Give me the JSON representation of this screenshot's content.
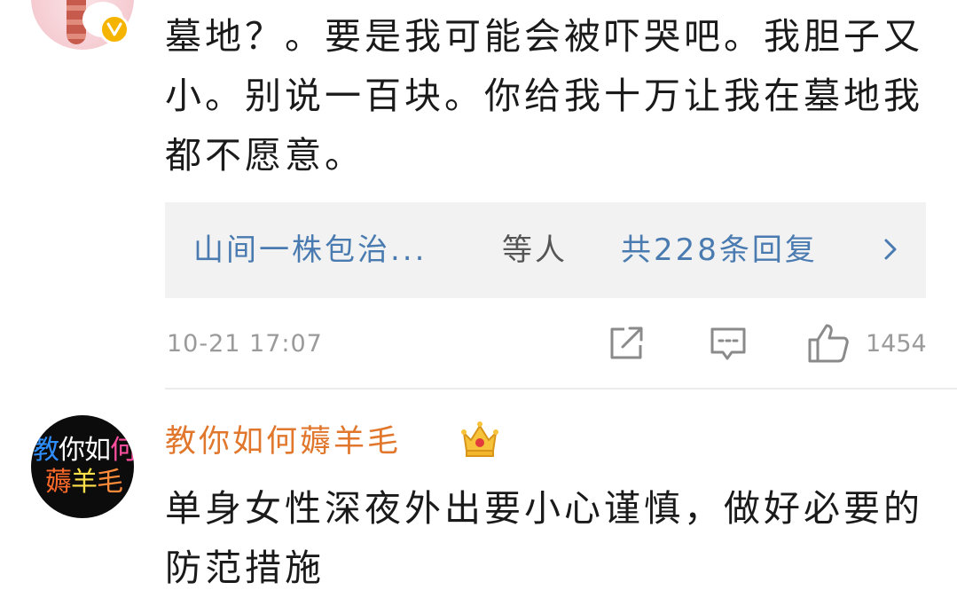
{
  "comments": [
    {
      "text": "墓地？。要是我可能会被吓哭吧。我胆子又小。别说一百块。你给我十万让我在墓地我都不愿意。",
      "verified_badge": "v-badge-icon",
      "replies": {
        "names": "山间一株包治...",
        "suffix": "等人",
        "count_label": "共228条回复"
      },
      "time": "10-21  17:07",
      "like_count": "1454"
    },
    {
      "username": "教你如何薅羊毛",
      "avatar_text": {
        "line1": [
          "教",
          "你",
          "如",
          "何"
        ],
        "line2": [
          "薅",
          "羊",
          "毛"
        ]
      },
      "text": "单身女性深夜外出要小心谨慎，做好必要的防范措施"
    }
  ],
  "colors": {
    "link_blue": "#4a7bb0",
    "username_orange": "#e0772c",
    "meta_gray": "#9a9a9a",
    "badge_gold": "#f5b400"
  }
}
